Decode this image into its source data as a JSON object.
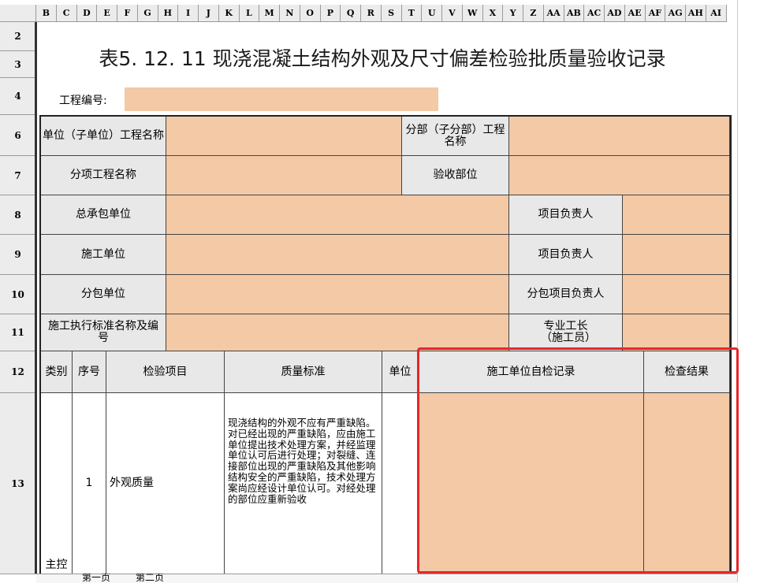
{
  "columns": [
    "B",
    "C",
    "D",
    "E",
    "F",
    "G",
    "H",
    "I",
    "J",
    "K",
    "L",
    "M",
    "N",
    "O",
    "P",
    "Q",
    "R",
    "S",
    "T",
    "U",
    "V",
    "W",
    "X",
    "Y",
    "Z",
    "AA",
    "AB",
    "AC",
    "AD",
    "AE",
    "AF",
    "AG",
    "AH",
    "AI"
  ],
  "rows": [
    "2",
    "3",
    "4",
    "6",
    "7",
    "8",
    "9",
    "10",
    "11",
    "12",
    "13"
  ],
  "title": "表5. 12. 11  现浇混凝土结构外观及尺寸偏差检验批质量验收记录",
  "project_no_label": "工程编号:",
  "labels": {
    "unit_project": "单位（子单位）工程名称",
    "sub_project": "分部（子分部）工程名称",
    "item_project": "分项工程名称",
    "accept_part": "验收部位",
    "general_contractor": "总承包单位",
    "project_manager": "项目负责人",
    "construction_unit": "施工单位",
    "project_manager2": "项目负责人",
    "sub_contractor": "分包单位",
    "sub_manager": "分包项目负责人",
    "standard": "施工执行标准名称及编号",
    "foreman": "专业工长（施工员）"
  },
  "table_headers": {
    "category": "类别",
    "seq": "序号",
    "item": "检验项目",
    "standard": "质量标准",
    "unit": "单位",
    "self_check": "施工单位自检记录",
    "result": "检查结果"
  },
  "row13": {
    "seq": "1",
    "item": "外观质量",
    "category": "主控",
    "standard": "现浇结构的外观不应有严重缺陷。对已经出现的严重缺陷，应由施工单位提出技术处理方案，并经监理单位认可后进行处理；对裂缝、连接部位出现的严重缺陷及其他影响结构安全的严重缺陷，技术处理方案尚应经设计单位认可。对经处理的部位应重新验收"
  },
  "sheet_tabs": [
    "第一页",
    "第二页"
  ],
  "colors": {
    "input_fill": "#f3c9a6",
    "label_fill": "#e8e8e8",
    "highlight": "#e8262a"
  }
}
